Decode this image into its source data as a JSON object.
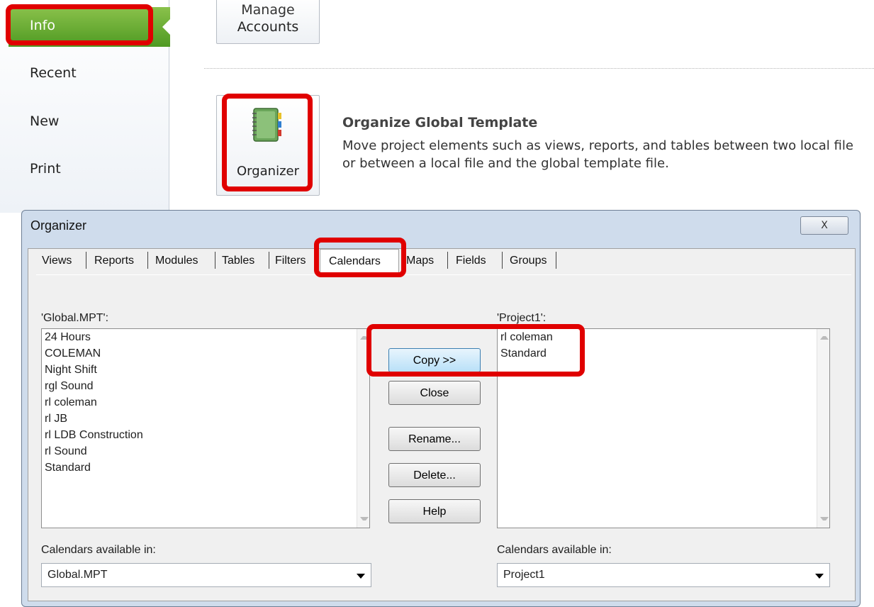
{
  "sidebar": {
    "items": [
      {
        "label": "Info"
      },
      {
        "label": "Recent"
      },
      {
        "label": "New"
      },
      {
        "label": "Print"
      }
    ]
  },
  "manage_accounts": {
    "line1": "Manage",
    "line2": "Accounts"
  },
  "organize": {
    "button_label": "Organizer",
    "title": "Organize Global Template",
    "description_line1": "Move project elements such as views, reports, and tables between two local file",
    "description_line2": "or between a local file and the global template file."
  },
  "dialog": {
    "title": "Organizer",
    "close_glyph": "X",
    "tabs": [
      "Views",
      "Reports",
      "Modules",
      "Tables",
      "Filters",
      "Calendars",
      "Maps",
      "Fields",
      "Groups"
    ],
    "selected_tab": "Calendars",
    "left": {
      "label": "'Global.MPT':",
      "items": [
        "24 Hours",
        "COLEMAN",
        "Night Shift",
        "rgl Sound",
        "rl coleman",
        "rl JB",
        "rl LDB Construction",
        "rl Sound",
        "Standard"
      ],
      "available_label": "Calendars available in:",
      "available_value": "Global.MPT"
    },
    "right": {
      "label": "'Project1':",
      "items": [
        "rl coleman",
        "Standard"
      ],
      "available_label": "Calendars available in:",
      "available_value": "Project1"
    },
    "buttons": {
      "copy": "Copy >>",
      "close": "Close",
      "rename": "Rename...",
      "delete": "Delete...",
      "help": "Help"
    }
  },
  "colors": {
    "accent_green": "#4f9a22",
    "highlight_red": "#e00000",
    "dialog_frame": "#cfdcec"
  }
}
